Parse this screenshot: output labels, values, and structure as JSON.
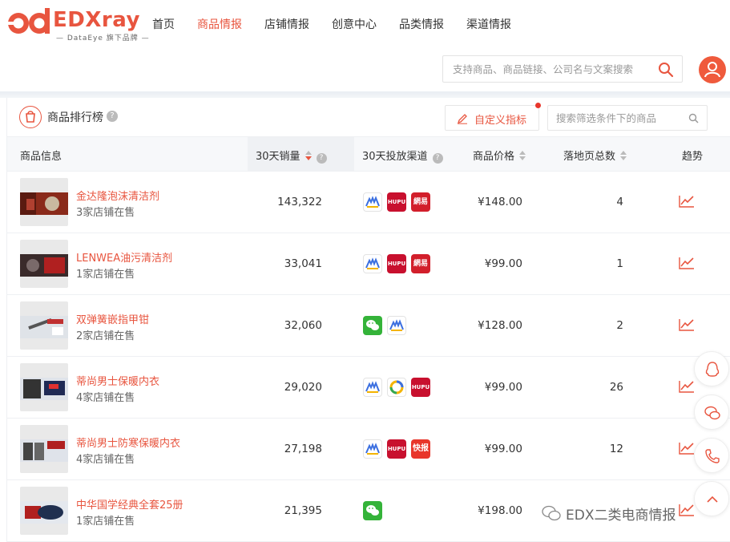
{
  "brand": {
    "logo_mark": "ed",
    "name": "EDXray",
    "tagline": "— DataEye 旗下品牌 —"
  },
  "nav": [
    {
      "label": "首页",
      "active": false
    },
    {
      "label": "商品情报",
      "active": true
    },
    {
      "label": "店铺情报",
      "active": false
    },
    {
      "label": "创意中心",
      "active": false
    },
    {
      "label": "品类情报",
      "active": false
    },
    {
      "label": "渠道情报",
      "active": false
    }
  ],
  "search": {
    "placeholder": "支持商品、商品链接、公司名与文案搜索"
  },
  "panel": {
    "title": "商品排行榜",
    "help": "?",
    "custom_button": "自定义指标",
    "filter_placeholder": "搜索筛选条件下的商品"
  },
  "table": {
    "headers": {
      "product": "商品信息",
      "sales": "30天销量",
      "channels": "30天投放渠道",
      "price": "商品价格",
      "pages": "落地页总数",
      "trend": "趋势"
    },
    "sorted_column": "sales",
    "sort_direction": "desc",
    "rows": [
      {
        "name": "金达隆泡沫清洁剂",
        "stores": "3家店铺在售",
        "sales": "143,322",
        "channels": [
          "jl",
          "hupu",
          "wy"
        ],
        "price": "¥148.00",
        "pages": "4"
      },
      {
        "name": "LENWEA油污清洁剂",
        "stores": "1家店铺在售",
        "sales": "33,041",
        "channels": [
          "jl",
          "hupu",
          "wy"
        ],
        "price": "¥99.00",
        "pages": "1"
      },
      {
        "name": "双弹簧嵌指甲钳",
        "stores": "2家店铺在售",
        "sales": "32,060",
        "channels": [
          "wx",
          "jl"
        ],
        "price": "¥128.00",
        "pages": "2"
      },
      {
        "name": "蒂尚男士保暖内衣",
        "stores": "4家店铺在售",
        "sales": "29,020",
        "channels": [
          "jl",
          "tt",
          "hupu"
        ],
        "price": "¥99.00",
        "pages": "26"
      },
      {
        "name": "蒂尚男士防寒保暖内衣",
        "stores": "4家店铺在售",
        "sales": "27,198",
        "channels": [
          "jl",
          "hupu",
          "ks"
        ],
        "price": "¥99.00",
        "pages": "12"
      },
      {
        "name": "中华国学经典全套25册",
        "stores": "1家店铺在售",
        "sales": "21,395",
        "channels": [
          "wx"
        ],
        "price": "¥198.00",
        "pages": ""
      }
    ]
  },
  "channel_labels": {
    "hupu": "HUPU",
    "wy": "網易",
    "ks": "快报",
    "wx": "✉"
  },
  "float_buttons": [
    "qq-icon",
    "wechat-icon",
    "phone-icon",
    "back-to-top-icon"
  ],
  "watermark": "EDX二类电商情报",
  "colors": {
    "accent": "#e8553f",
    "hupu": "#c8102e",
    "wechat": "#34b339"
  }
}
